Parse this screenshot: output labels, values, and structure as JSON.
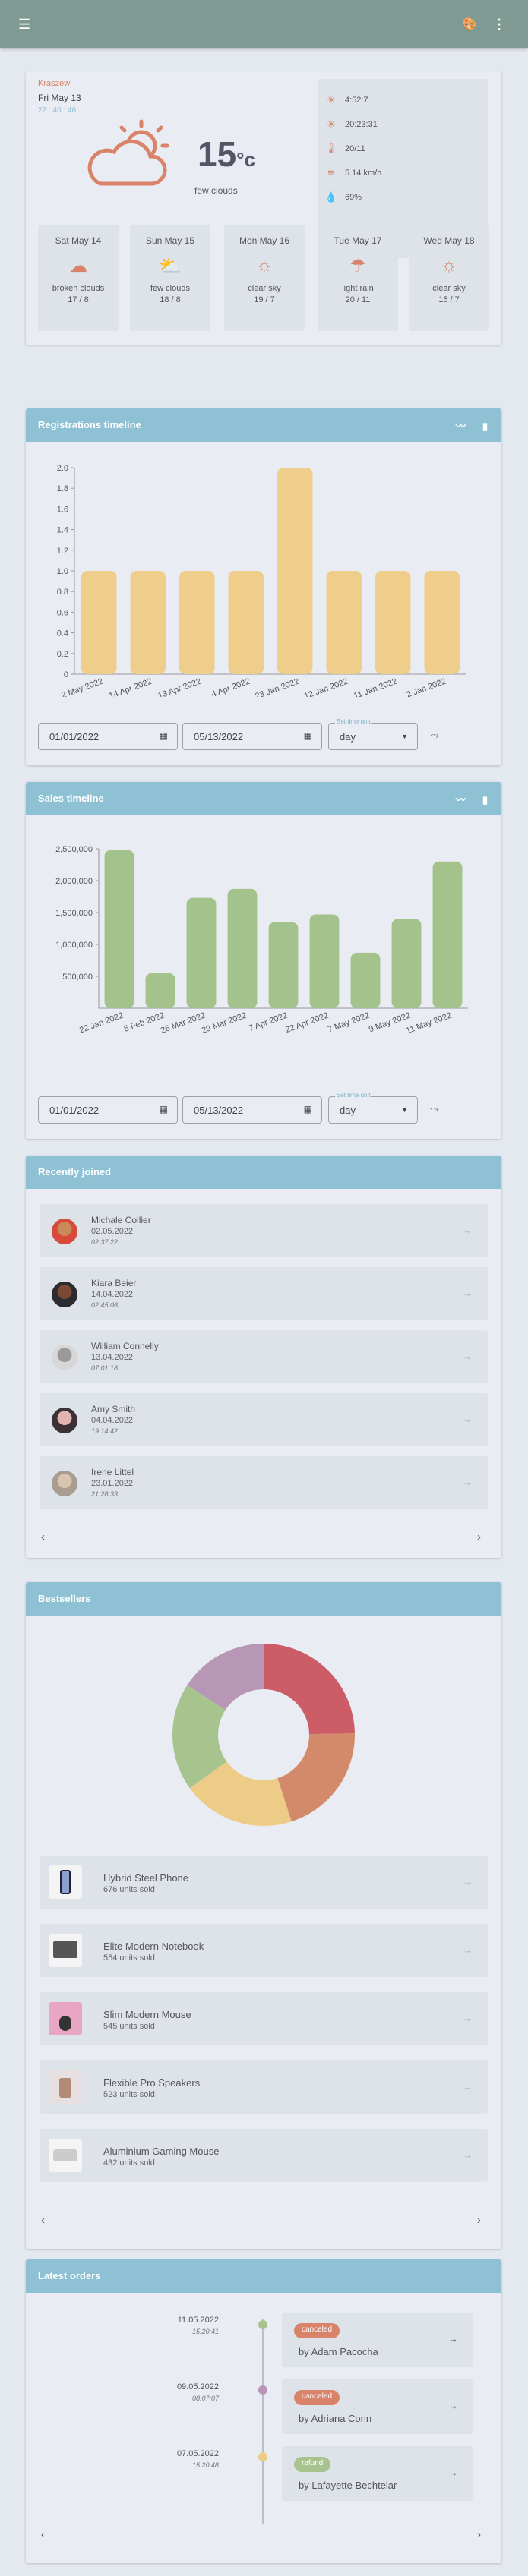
{
  "weather": {
    "city": "Kraszew",
    "date": "Fri May 13",
    "time": "22 : 40 : 46",
    "temp": "15",
    "unit": "°c",
    "desc": "few clouds",
    "details": [
      {
        "icon": "sunrise-icon",
        "value": "4:52:7"
      },
      {
        "icon": "sunset-icon",
        "value": "20:23:31"
      },
      {
        "icon": "thermometer-icon",
        "value": "20/11"
      },
      {
        "icon": "wind-icon",
        "value": "5.14 km/h"
      },
      {
        "icon": "humidity-icon",
        "value": "69%"
      }
    ],
    "forecast": [
      {
        "day": "Sat May 14",
        "icon": "cloud-icon",
        "desc": "broken clouds",
        "temps": "17 / 8"
      },
      {
        "day": "Sun May 15",
        "icon": "partly-cloudy-icon",
        "desc": "few clouds",
        "temps": "18 / 8"
      },
      {
        "day": "Mon May 16",
        "icon": "sun-icon",
        "desc": "clear sky",
        "temps": "19 / 7"
      },
      {
        "day": "Tue May 17",
        "icon": "rain-icon",
        "desc": "light rain",
        "temps": "20 / 11"
      },
      {
        "day": "Wed May 18",
        "icon": "sun-icon",
        "desc": "clear sky",
        "temps": "15 / 7"
      }
    ]
  },
  "registrations": {
    "title": "Registrations timeline",
    "from": "01/01/2022",
    "to": "05/13/2022",
    "set_time_unit_label": "Set time unit",
    "unit": "day"
  },
  "sales": {
    "title": "Sales timeline",
    "from": "01/01/2022",
    "to": "05/13/2022",
    "set_time_unit_label": "Set time unit",
    "unit": "day"
  },
  "chart_data": [
    {
      "type": "bar",
      "categories": [
        "2 May 2022",
        "14 Apr 2022",
        "13 Apr 2022",
        "4 Apr 2022",
        "23 Jan 2022",
        "12 Jan 2022",
        "11 Jan 2022",
        "2 Jan 2022"
      ],
      "values": [
        1,
        1,
        1,
        1,
        2,
        1,
        1,
        1
      ],
      "yticks": [
        "0",
        "0.2",
        "0.4",
        "0.6",
        "0.8",
        "1.0",
        "1.2",
        "1.4",
        "1.6",
        "1.8",
        "2.0"
      ],
      "ylim": [
        0,
        2
      ],
      "color": "#efcd8a"
    },
    {
      "type": "bar",
      "categories": [
        "22 Jan 2022",
        "5 Feb 2022",
        "26 Mar 2022",
        "29 Mar 2022",
        "7 Apr 2022",
        "22 Apr 2022",
        "7 May 2022",
        "9 May 2022",
        "11 May 2022"
      ],
      "values": [
        2480000,
        550000,
        1730000,
        1870000,
        1350000,
        1470000,
        870000,
        1400000,
        2300000
      ],
      "yticks": [
        "500,000",
        "1,000,000",
        "1,500,000",
        "2,000,000",
        "2,500,000"
      ],
      "ylim": [
        0,
        2500000
      ],
      "color": "#a4c28c"
    }
  ],
  "recently_joined": {
    "title": "Recently joined",
    "users": [
      {
        "name": "Michale Collier",
        "date": "02.05.2022",
        "time": "02:37:22"
      },
      {
        "name": "Kiara Beier",
        "date": "14.04.2022",
        "time": "02:45:06"
      },
      {
        "name": "William Connelly",
        "date": "13.04.2022",
        "time": "07:01:18"
      },
      {
        "name": "Amy Smith",
        "date": "04.04.2022",
        "time": "19:14:42"
      },
      {
        "name": "Irene Littel",
        "date": "23.01.2022",
        "time": "21:28:33"
      }
    ]
  },
  "bestsellers": {
    "title": "Bestsellers",
    "pie_colors": [
      "#cc5c66",
      "#d38a6a",
      "#eccc86",
      "#a7c48f",
      "#b896b6"
    ],
    "products": [
      {
        "name": "Hybrid Steel Phone",
        "sold": "676 units sold",
        "units": 676
      },
      {
        "name": "Elite Modern Notebook",
        "sold": "554 units sold",
        "units": 554
      },
      {
        "name": "Slim Modern Mouse",
        "sold": "545 units sold",
        "units": 545
      },
      {
        "name": "Flexible Pro Speakers",
        "sold": "523 units sold",
        "units": 523
      },
      {
        "name": "Aluminium Gaming Mouse",
        "sold": "432 units sold",
        "units": 432
      }
    ]
  },
  "orders": {
    "title": "Latest orders",
    "items": [
      {
        "date": "11.05.2022",
        "time": "15:20:41",
        "status": "canceled",
        "status_color": "#d9846a",
        "dot_color": "#a7c48f",
        "by": "by Adam Pacocha"
      },
      {
        "date": "09.05.2022",
        "time": "08:07:07",
        "status": "canceled",
        "status_color": "#d9846a",
        "dot_color": "#b896b6",
        "by": "by Adriana Conn"
      },
      {
        "date": "07.05.2022",
        "time": "15:20:48",
        "status": "refund",
        "status_color": "#a7c48f",
        "dot_color": "#eccc86",
        "by": "by Lafayette Bechtelar"
      }
    ]
  }
}
